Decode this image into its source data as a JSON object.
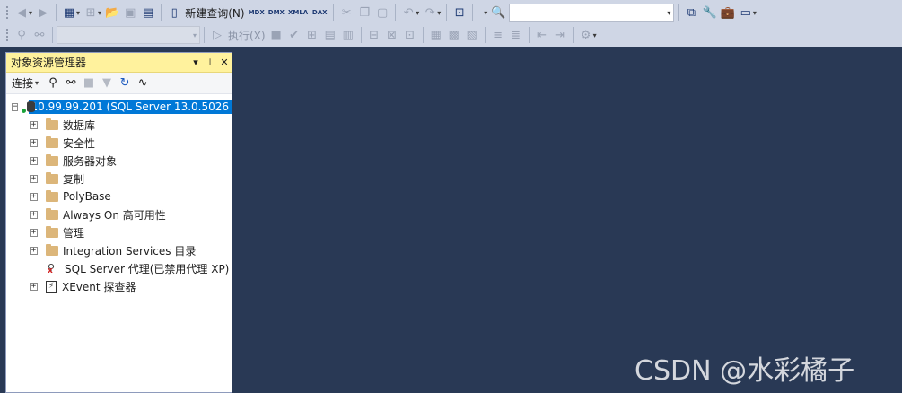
{
  "toolbar": {
    "new_query_label": "新建查询(N)",
    "mdx_label": "MDX",
    "dmx_label": "DMX",
    "xmla_label": "XMLA",
    "dax_label": "DAX",
    "execute_label": "执行(X)"
  },
  "object_explorer": {
    "title": "对象资源管理器",
    "connect_label": "连接",
    "root": "10.99.99.201 (SQL Server 13.0.5026",
    "items": [
      {
        "label": "数据库",
        "icon": "folder-icon",
        "expandable": true
      },
      {
        "label": "安全性",
        "icon": "folder-icon",
        "expandable": true
      },
      {
        "label": "服务器对象",
        "icon": "folder-icon",
        "expandable": true
      },
      {
        "label": "复制",
        "icon": "folder-icon",
        "expandable": true
      },
      {
        "label": "PolyBase",
        "icon": "folder-icon",
        "expandable": true
      },
      {
        "label": "Always On 高可用性",
        "icon": "folder-icon",
        "expandable": true
      },
      {
        "label": "管理",
        "icon": "folder-icon",
        "expandable": true
      },
      {
        "label": "Integration Services 目录",
        "icon": "folder-icon",
        "expandable": true
      },
      {
        "label": "SQL Server 代理(已禁用代理 XP)",
        "icon": "sql-agent-disabled-icon",
        "expandable": false
      },
      {
        "label": "XEvent 探查器",
        "icon": "xevent-icon",
        "expandable": true
      }
    ]
  },
  "watermark": "CSDN @水彩橘子",
  "colors": {
    "editor_background": "#293955",
    "toolbar_background": "#cfd6e5",
    "panel_title_background": "#fff29d",
    "selection": "#0078d7",
    "folder": "#dcb67a"
  }
}
